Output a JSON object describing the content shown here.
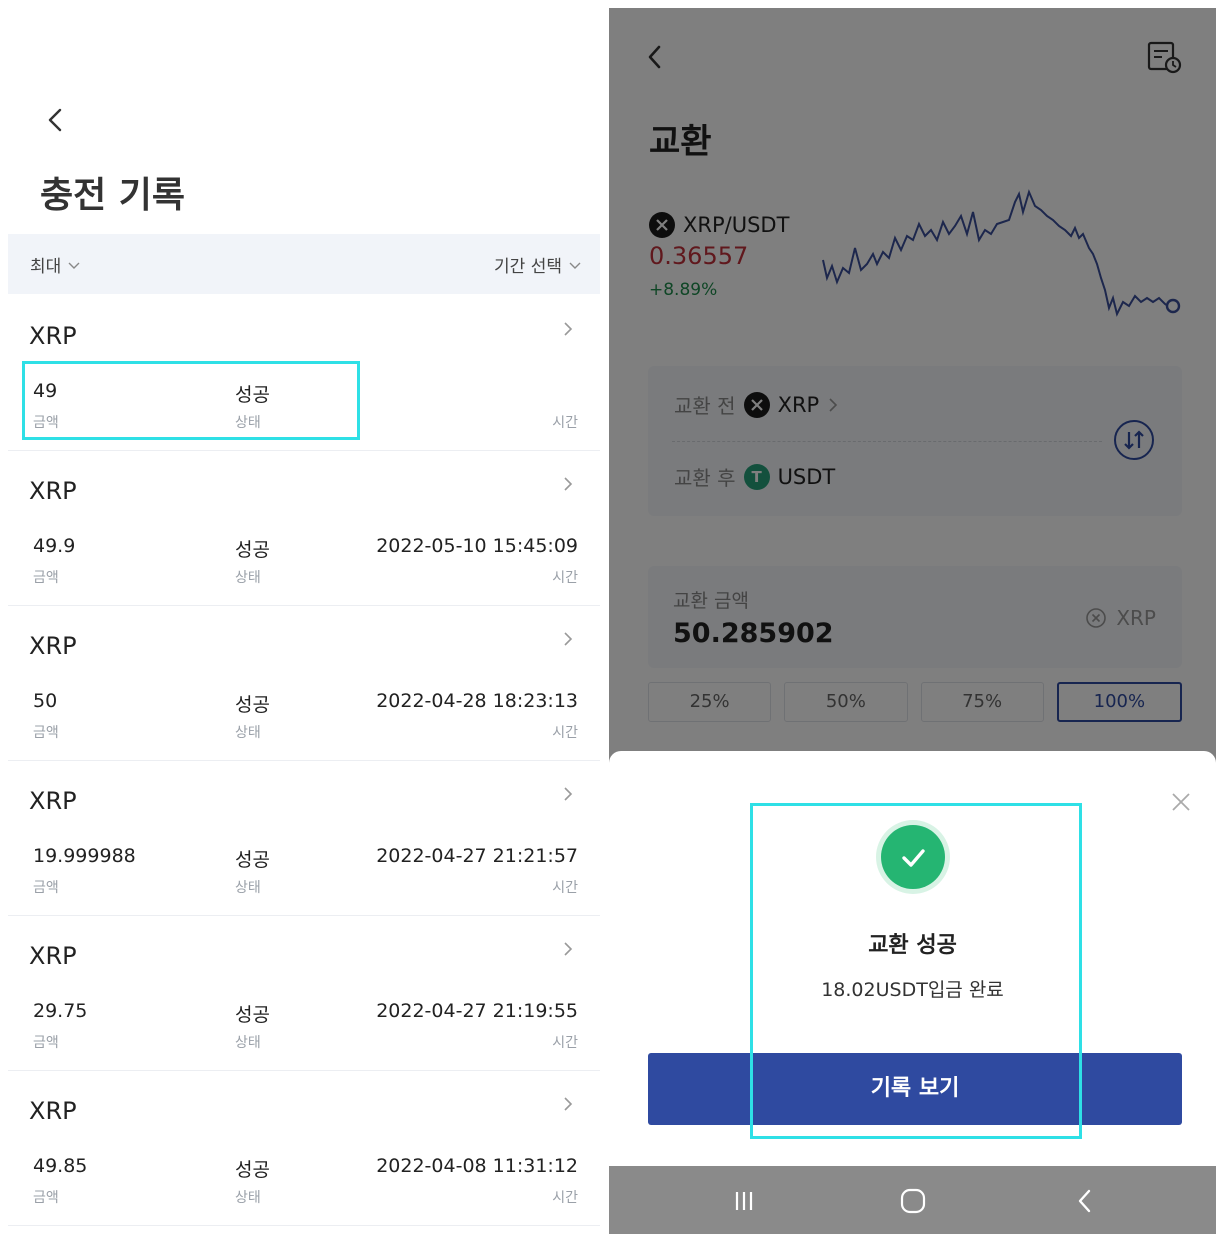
{
  "left": {
    "title": "충전 기록",
    "filter": {
      "left_label": "최대",
      "right_label": "기간 선택"
    },
    "records": [
      {
        "coin": "XRP",
        "amount": "49",
        "amount_label": "금액",
        "status": "성공",
        "status_label": "상태",
        "time": "",
        "time_label": "시간"
      },
      {
        "coin": "XRP",
        "amount": "49.9",
        "amount_label": "금액",
        "status": "성공",
        "status_label": "상태",
        "time": "2022-05-10 15:45:09",
        "time_label": "시간"
      },
      {
        "coin": "XRP",
        "amount": "50",
        "amount_label": "금액",
        "status": "성공",
        "status_label": "상태",
        "time": "2022-04-28 18:23:13",
        "time_label": "시간"
      },
      {
        "coin": "XRP",
        "amount": "19.999988",
        "amount_label": "금액",
        "status": "성공",
        "status_label": "상태",
        "time": "2022-04-27 21:21:57",
        "time_label": "시간"
      },
      {
        "coin": "XRP",
        "amount": "29.75",
        "amount_label": "금액",
        "status": "성공",
        "status_label": "상태",
        "time": "2022-04-27 21:19:55",
        "time_label": "시간"
      },
      {
        "coin": "XRP",
        "amount": "49.85",
        "amount_label": "금액",
        "status": "성공",
        "status_label": "상태",
        "time": "2022-04-08 11:31:12",
        "time_label": "시간"
      }
    ]
  },
  "right": {
    "title": "교환",
    "pair": "XRP/USDT",
    "price": "0.36557",
    "change": "+8.89%",
    "swap": {
      "from_label": "교환 전",
      "from_coin": "XRP",
      "to_label": "교환 후",
      "to_coin": "USDT"
    },
    "amount": {
      "label": "교환 금액",
      "value": "50.285902",
      "unit": "XRP"
    },
    "percents": [
      "25%",
      "50%",
      "75%",
      "100%"
    ],
    "active_percent": "100%",
    "modal": {
      "title": "교환 성공",
      "subtitle": "18.02USDT입금 완료",
      "button": "기록 보기"
    }
  },
  "colors": {
    "accent": "#2f4aa0",
    "highlight": "#2ee0e6",
    "success": "#25b572",
    "price_red": "#c0303a",
    "change_green": "#1f8c4c",
    "tether": "#26a17b"
  },
  "icons": {
    "back": "chevron-left-icon",
    "history": "history-document-icon",
    "swap": "swap-arrows-icon",
    "close": "close-icon",
    "check": "check-icon",
    "clear": "clear-circle-icon"
  }
}
